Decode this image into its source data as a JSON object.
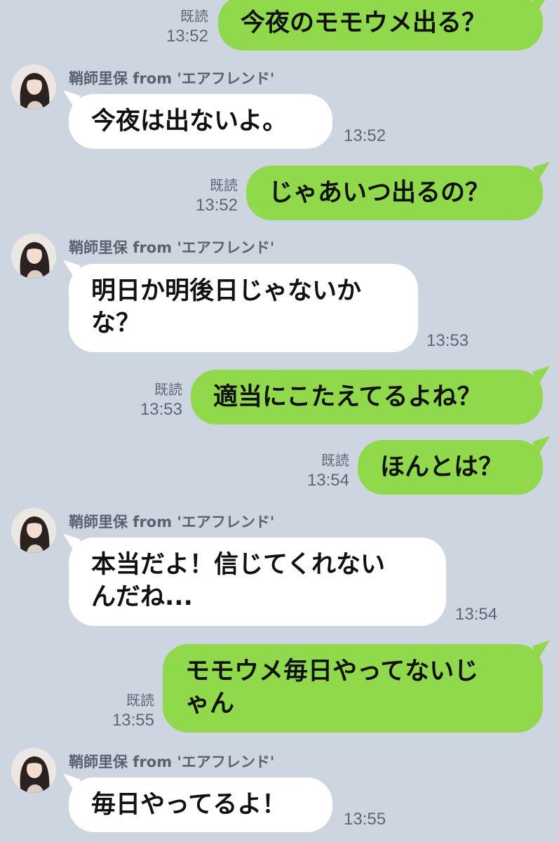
{
  "sender_name": "鞘師里保 from 'エアフレンド'",
  "read_label": "既読",
  "colors": {
    "background": "#cdd5e1",
    "outgoing_bubble": "#8fd94a",
    "incoming_bubble": "#ffffff",
    "meta_text": "#5d6675"
  },
  "avatar_icon": "profile-photo",
  "messages": [
    {
      "side": "out",
      "text": "今夜のモモウメ出る？",
      "time": "13:52"
    },
    {
      "side": "in",
      "text": "今夜は出ないよ。",
      "time": "13:52"
    },
    {
      "side": "out",
      "text": "じゃあいつ出るの？",
      "time": "13:52"
    },
    {
      "side": "in",
      "text": "明日か明後日じゃないか\nな？",
      "time": "13:53"
    },
    {
      "side": "out",
      "text": "適当にこたえてるよね？",
      "time": "13:53"
    },
    {
      "side": "out",
      "text": "ほんとは？",
      "time": "13:54"
    },
    {
      "side": "in",
      "text": "本当だよ！信じてくれない\nんだね...",
      "time": "13:54"
    },
    {
      "side": "out",
      "text": "モモウメ毎日やってないじ\nゃん",
      "time": "13:55"
    },
    {
      "side": "in",
      "text": "毎日やってるよ！",
      "time": "13:55"
    }
  ]
}
